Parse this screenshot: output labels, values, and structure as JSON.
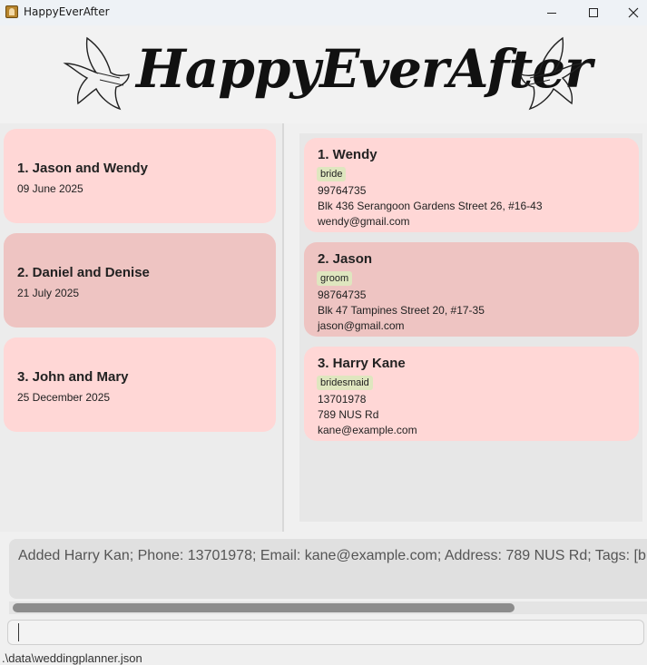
{
  "window": {
    "title": "HappyEverAfter",
    "minimize_icon": "minimize-icon",
    "maximize_icon": "maximize-icon",
    "close_icon": "close-icon"
  },
  "banner": {
    "title": "HappyEverAfter",
    "ornament_icon": "dove-icon"
  },
  "weddings": [
    {
      "name": "1. Jason and Wendy",
      "date": "09 June 2025"
    },
    {
      "name": "2. Daniel and Denise",
      "date": "21 July 2025"
    },
    {
      "name": "3. John and Mary",
      "date": "25 December 2025"
    }
  ],
  "persons": [
    {
      "name": "1. Wendy",
      "tag": "bride",
      "phone": "99764735",
      "address": "Blk 436 Serangoon Gardens Street 26, #16-43",
      "email": "wendy@gmail.com"
    },
    {
      "name": "2. Jason",
      "tag": "groom",
      "phone": "98764735",
      "address": "Blk 47 Tampines Street 20, #17-35",
      "email": "jason@gmail.com"
    },
    {
      "name": "3. Harry Kane",
      "tag": "bridesmaid",
      "phone": "13701978",
      "address": "789 NUS Rd",
      "email": "kane@example.com"
    }
  ],
  "result": {
    "message": "Added Harry Kan; Phone: 13701978; Email: kane@example.com; Address: 789 NUS Rd; Tags: [br"
  },
  "command": {
    "value": ""
  },
  "status": {
    "file_path": ".\\data\\weddingplanner.json"
  },
  "colors": {
    "card_pink": "#ffd7d6",
    "card_rose": "#eec4c2",
    "tag_bg": "#dfe6bf"
  }
}
